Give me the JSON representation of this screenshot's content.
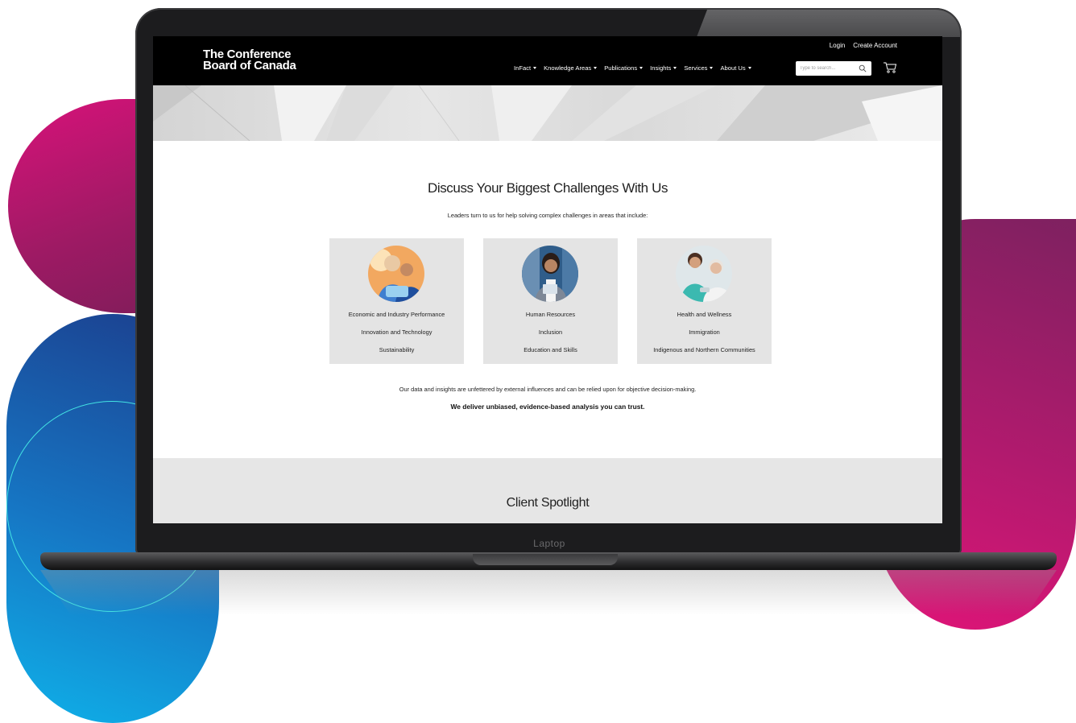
{
  "device": {
    "label": "Laptop"
  },
  "brand": {
    "logo_line1": "The Conference",
    "logo_line2": "Board of Canada"
  },
  "header": {
    "login": "Login",
    "create_account": "Create Account",
    "nav": [
      {
        "label": "InFact"
      },
      {
        "label": "Knowledge Areas"
      },
      {
        "label": "Publications"
      },
      {
        "label": "Insights"
      },
      {
        "label": "Services"
      },
      {
        "label": "About Us"
      }
    ],
    "search": {
      "placeholder": "Type to search..."
    },
    "icons": {
      "search": "search-icon",
      "cart": "cart-icon",
      "caret": "caret-down-icon"
    }
  },
  "main": {
    "title": "Discuss Your Biggest Challenges With Us",
    "subtitle": "Leaders turn to us for help solving complex challenges in areas that include:",
    "cards": [
      {
        "items": [
          "Economic and Industry Performance",
          "Innovation and Technology",
          "Sustainability"
        ]
      },
      {
        "items": [
          "Human Resources",
          "Inclusion",
          "Education and Skills"
        ]
      },
      {
        "items": [
          "Health and Wellness",
          "Immigration",
          "Indigenous and Northern Communities"
        ]
      }
    ],
    "statement": "Our data and insights are unfettered by external influences and can be relied upon for objective decision-making.",
    "statement_strong": "We deliver unbiased, evidence-based analysis you can trust."
  },
  "spotlight": {
    "title": "Client Spotlight"
  },
  "colors": {
    "navbar": "#000000",
    "card_bg": "#e4e4e4",
    "magenta": "#d8127a",
    "blue": "#1676c4",
    "cyan": "#0fb1e9"
  }
}
